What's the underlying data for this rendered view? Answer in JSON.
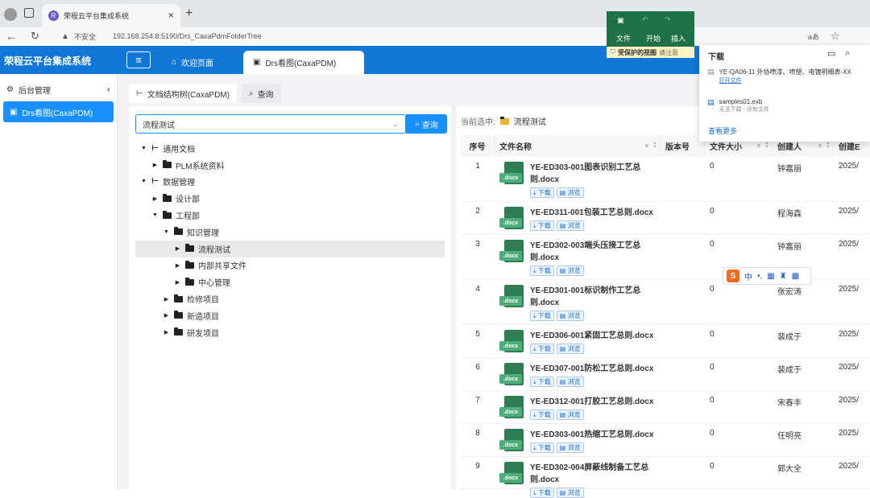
{
  "browser": {
    "tab_title": "荣程云平台集成系统",
    "address_warning": "不安全",
    "address_url": "192.168.254.8:5190/Drs_CaxaPdmFolderTree"
  },
  "header": {
    "brand": "荣程云平台集成系统",
    "tabs": [
      {
        "label": "欢迎页面"
      },
      {
        "label": "Drs看图(CaxaPDM)"
      }
    ]
  },
  "sidebar": {
    "items": [
      {
        "label": "后台管理"
      },
      {
        "label": "Drs看图(CaxaPDM)"
      }
    ]
  },
  "subtabs": [
    {
      "label": "文档结构树(CaxaPDM)"
    },
    {
      "label": "查询"
    }
  ],
  "search": {
    "value": "流程测试",
    "button": "查询"
  },
  "tree": [
    {
      "label": "通用文档",
      "level": 0,
      "expanded": true,
      "icon": "tree-icon"
    },
    {
      "label": "PLM系统资料",
      "level": 1,
      "expanded": false,
      "icon": "folder-icon"
    },
    {
      "label": "数据管理",
      "level": 0,
      "expanded": true,
      "icon": "tree-icon"
    },
    {
      "label": "设计部",
      "level": 1,
      "expanded": false,
      "icon": "folder-icon"
    },
    {
      "label": "工程部",
      "level": 1,
      "expanded": true,
      "icon": "folder-open-icon"
    },
    {
      "label": "知识管理",
      "level": 2,
      "expanded": true,
      "icon": "folder-open-icon"
    },
    {
      "label": "流程测试",
      "level": 3,
      "expanded": false,
      "icon": "folder-icon",
      "selected": true
    },
    {
      "label": "内部共享文件",
      "level": 3,
      "expanded": false,
      "icon": "folder-icon"
    },
    {
      "label": "中心管理",
      "level": 3,
      "expanded": false,
      "icon": "folder-icon"
    },
    {
      "label": "检修项目",
      "level": 2,
      "expanded": false,
      "icon": "folder-icon"
    },
    {
      "label": "新造项目",
      "level": 2,
      "expanded": false,
      "icon": "folder-icon"
    },
    {
      "label": "研发项目",
      "level": 2,
      "expanded": false,
      "icon": "folder-icon"
    }
  ],
  "current": {
    "label": "当前选中:",
    "value": "流程测试"
  },
  "table": {
    "headers": [
      "序号",
      "文件名称",
      "版本号",
      "文件大小",
      "创建人",
      "创建E"
    ],
    "download_label": "下载",
    "preview_label": "浏览",
    "badge": ".docx",
    "rows": [
      {
        "no": "1",
        "name": "YE-ED303-001图表识别工艺总则.docx",
        "size": "0",
        "creator": "钟嘉丽",
        "date": "2025/"
      },
      {
        "no": "2",
        "name": "YE-ED311-001包装工艺总则.docx",
        "size": "0",
        "creator": "程海森",
        "date": "2025/"
      },
      {
        "no": "3",
        "name": "YE-ED302-003端头压接工艺总则.docx",
        "size": "0",
        "creator": "钟嘉丽",
        "date": "2025/"
      },
      {
        "no": "4",
        "name": "YE-ED301-001标识制作工艺总则.docx",
        "size": "0",
        "creator": "张宏涛",
        "date": "2025/"
      },
      {
        "no": "5",
        "name": "YE-ED306-001紧固工艺总则.docx",
        "size": "0",
        "creator": "裴成于",
        "date": "2025/"
      },
      {
        "no": "6",
        "name": "YE-ED307-001防松工艺总则.docx",
        "size": "0",
        "creator": "裴成于",
        "date": "2025/"
      },
      {
        "no": "7",
        "name": "YE-ED312-001打胶工艺总则.docx",
        "size": "0",
        "creator": "宋春丰",
        "date": "2025/"
      },
      {
        "no": "8",
        "name": "YE-ED303-001热缩工艺总则.docx",
        "size": "0",
        "creator": "任明亮",
        "date": "2025/"
      },
      {
        "no": "9",
        "name": "YE-ED302-004屏蔽线制备工艺总则.docx",
        "size": "0",
        "creator": "郭大全",
        "date": "2025/"
      }
    ]
  },
  "word_popup": {
    "file": "文件",
    "start": "开始",
    "insert": "插入",
    "protected": "受保护的视图",
    "note": "请注意"
  },
  "downloads": {
    "title": "下载",
    "items": [
      {
        "name": "YE-QA06-11 外协喷漆、喷塑、电镀明细表-XX",
        "action": "打开文件"
      },
      {
        "name": "samples01.exb",
        "action": "无法下载 - 没有文件"
      }
    ],
    "more": "查看更多"
  },
  "ime": {
    "chars": [
      "中",
      "•,"
    ]
  }
}
